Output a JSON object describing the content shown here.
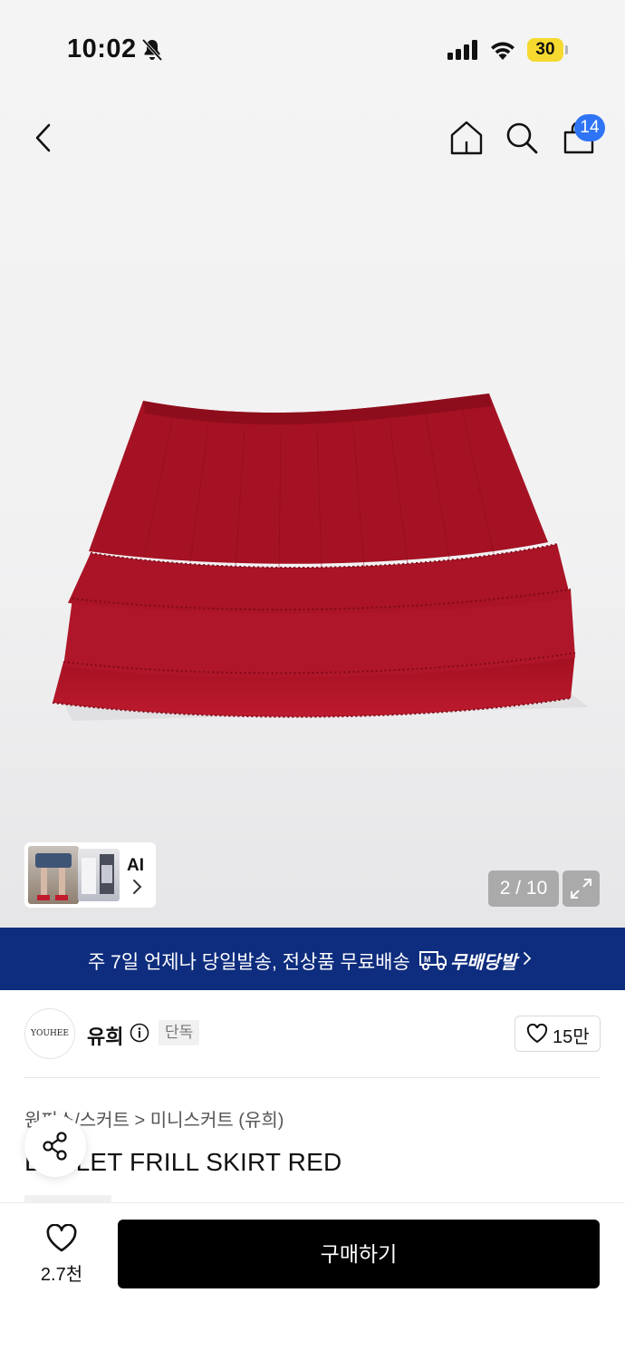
{
  "status_bar": {
    "time": "10:02",
    "battery": "30"
  },
  "nav": {
    "bag_count": "14"
  },
  "gallery": {
    "ai_label": "AI",
    "counter": "2 / 10"
  },
  "banner": {
    "text": "주 7일 언제나 당일발송, 전상품 무료배송",
    "badge": "무배당발"
  },
  "brand": {
    "logo_text": "YOUHEE",
    "name": "유희",
    "badge": "단독",
    "likes": "15만"
  },
  "product": {
    "breadcrumb": "원피스/스커트 > 미니스커트 (유희)",
    "title": "EYELET FRILL SKIRT RED"
  },
  "bottom": {
    "like_count": "2.7천",
    "buy_label": "구매하기"
  },
  "colors": {
    "banner": "#0e2d7e",
    "badge": "#2f74f5",
    "battery": "#f6d92f",
    "buy_button": "#000000",
    "skirt": "#b0162b"
  }
}
